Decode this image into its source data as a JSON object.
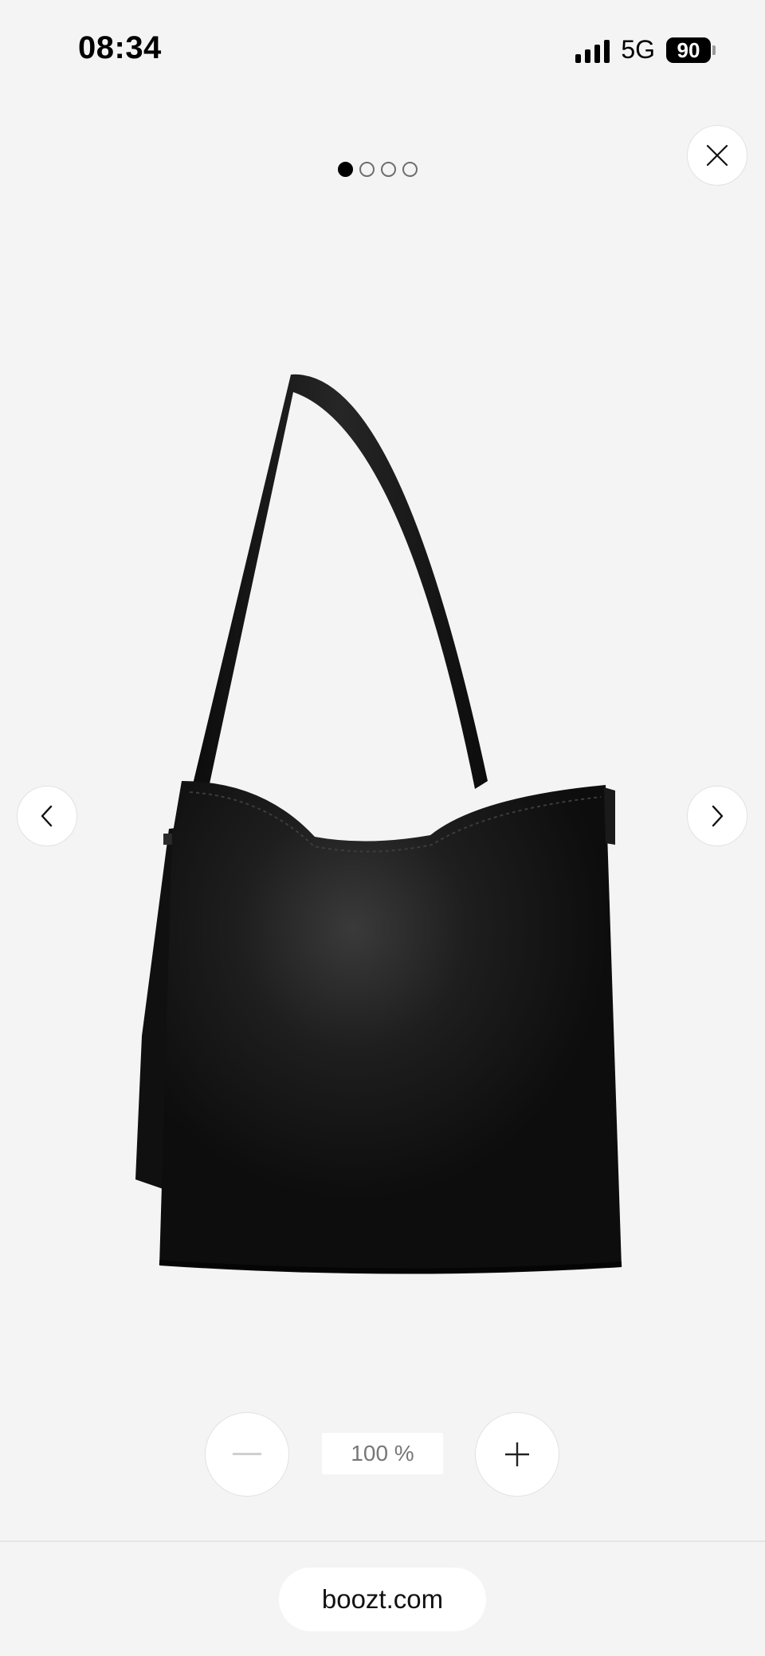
{
  "status_bar": {
    "time": "08:34",
    "network": "5G",
    "battery": "90",
    "icons": [
      "signal-bars-icon",
      "battery-icon"
    ]
  },
  "gallery": {
    "page_count": 4,
    "current_page": 1,
    "product_image_icon": "black-leather-shoulder-bag",
    "controls": {
      "close_icon": "close-icon",
      "prev_icon": "chevron-left-icon",
      "next_icon": "chevron-right-icon"
    }
  },
  "zoom": {
    "level": "100 %",
    "zoom_out_icon": "minus-icon",
    "zoom_in_icon": "plus-icon"
  },
  "browser": {
    "url": "boozt.com"
  },
  "colors": {
    "background": "#f4f4f4",
    "bag": "#141414",
    "button": "#ffffff"
  }
}
